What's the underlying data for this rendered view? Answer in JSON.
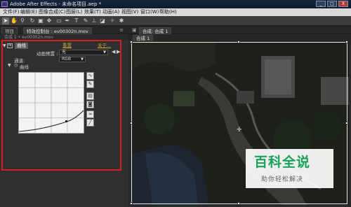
{
  "window": {
    "title": "Adobe After Effects - 未命名项目.aep *",
    "minimize": "_",
    "maximize": "□",
    "close": "X"
  },
  "menu": [
    "文件(F)",
    "编辑(E)",
    "图像合成(C)",
    "图层(L)",
    "效果(T)",
    "动画(A)",
    "视图(V)",
    "窗口(W)",
    "帮助(H)"
  ],
  "left_panel": {
    "tab_project": "项目",
    "tab_effect_controls": "特效控制台 : ev00302n.mov",
    "breadcrumb": "合成 1 • ev00302n.mov",
    "effect": {
      "badge": "fx",
      "name": "曲线",
      "reset": "重置",
      "about": "关于..."
    },
    "preset_label": "动画预置 :",
    "preset_value": "无",
    "channel_label": "通道:",
    "channel_value": "RGB",
    "curve_label": "曲线"
  },
  "right_panel": {
    "tab_comp": "合成: 合成 1",
    "sub_tab": "合成 1"
  },
  "watermark": {
    "title": "百科全说",
    "subtitle": "助你轻松解决"
  },
  "colors": {
    "highlight": "#d42020",
    "link": "#c9a43a",
    "watermark_green": "#19a15a"
  }
}
